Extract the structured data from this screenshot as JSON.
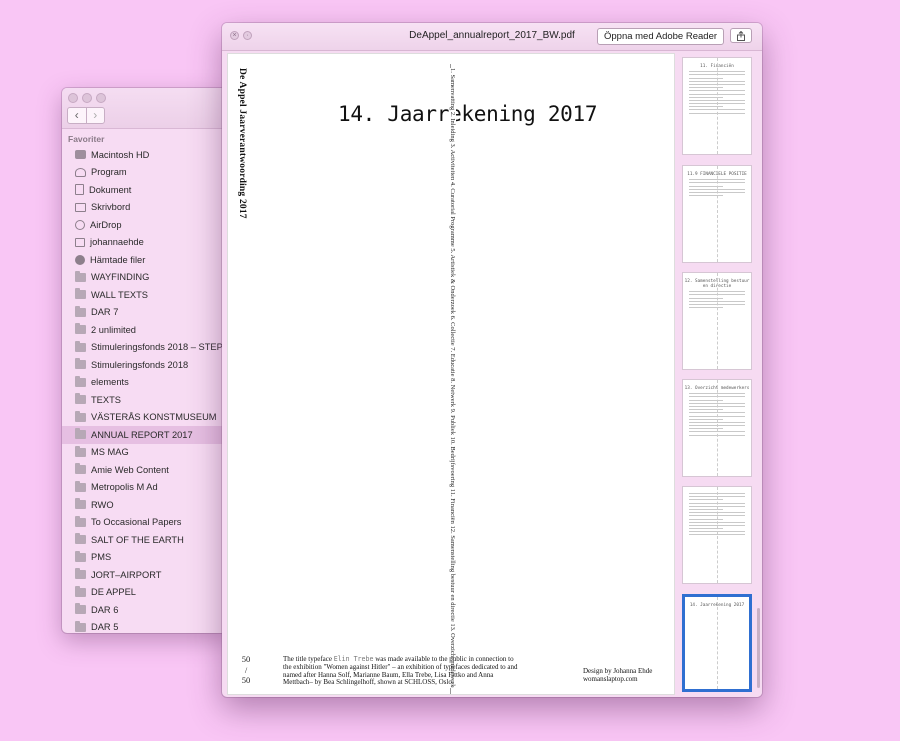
{
  "finder": {
    "favorites_label": "Favoriter",
    "items": [
      {
        "label": "Macintosh HD",
        "icon": "disk-icon"
      },
      {
        "label": "Program",
        "icon": "applications-icon"
      },
      {
        "label": "Dokument",
        "icon": "document-icon"
      },
      {
        "label": "Skrivbord",
        "icon": "desktop-icon"
      },
      {
        "label": "AirDrop",
        "icon": "airdrop-icon"
      },
      {
        "label": "johannaehde",
        "icon": "home-icon"
      },
      {
        "label": "Hämtade filer",
        "icon": "downloads-icon"
      },
      {
        "label": "WAYFINDING",
        "icon": "folder-icon"
      },
      {
        "label": "WALL TEXTS",
        "icon": "folder-icon"
      },
      {
        "label": "DAR 7",
        "icon": "folder-icon"
      },
      {
        "label": "2 unlimited",
        "icon": "folder-icon"
      },
      {
        "label": "Stimuleringsfonds 2018 – STEP",
        "icon": "folder-icon"
      },
      {
        "label": "Stimuleringsfonds 2018",
        "icon": "folder-icon"
      },
      {
        "label": "elements",
        "icon": "folder-icon"
      },
      {
        "label": "TEXTS",
        "icon": "folder-icon"
      },
      {
        "label": "VÄSTERÅS KONSTMUSEUM",
        "icon": "folder-icon"
      },
      {
        "label": "ANNUAL REPORT 2017",
        "icon": "folder-icon",
        "selected": true
      },
      {
        "label": "MS MAG",
        "icon": "folder-icon"
      },
      {
        "label": "Amie Web Content",
        "icon": "folder-icon"
      },
      {
        "label": "Metropolis M Ad",
        "icon": "folder-icon"
      },
      {
        "label": "RWO",
        "icon": "folder-icon"
      },
      {
        "label": "To Occasional Papers",
        "icon": "folder-icon"
      },
      {
        "label": "SALT OF THE EARTH",
        "icon": "folder-icon"
      },
      {
        "label": "PMS",
        "icon": "folder-icon"
      },
      {
        "label": "JORT–AIRPORT",
        "icon": "folder-icon"
      },
      {
        "label": "DE APPEL",
        "icon": "folder-icon"
      },
      {
        "label": "DAR 6",
        "icon": "folder-icon"
      },
      {
        "label": "DAR 5",
        "icon": "folder-icon"
      }
    ]
  },
  "pdf": {
    "filename": "DeAppel_annualreport_2017_BW.pdf",
    "open_button": "Öppna med Adobe Reader",
    "page": {
      "side_title": "De Appel  Jaarverantwoording 2017",
      "heading": "14. Jaarrekening 2017",
      "toc": "1. Samenvatting   2. Inleiding   3. Activiteiten   4. Curatorial Programme   5. Artistiek & Onderzoek   6. Collectie   7. Educatie   8. Netwerk   9. Publiek   10. Bedrijfsvoering   11. Financiën   12. Samenstelling bestuur en directie   13. Overzicht medewerkers   14. Jaarrekening 2017",
      "page_num_top": "50",
      "page_num_sep": "/",
      "page_num_bottom": "50",
      "credit_prefix": "The title typeface ",
      "credit_typeface": "Elin Trebe",
      "credit_suffix": " was made available to the public in connection to the exhibition \"Women against Hitler\" – an exhibition of typefaces dedicated to and named after Hanna Solf, Marianne Baum, Ella Trebe, Lisa Fittko and Anna Mettbach– by Bea Schlingelhoff, shown at SCHLOSS, Oslo.",
      "design_line1": "Design by Johanna Ehde",
      "design_line2": "womanslaptop.com"
    },
    "thumbnails": [
      {
        "title": "11. Financiën"
      },
      {
        "title": "11.9 FINANCIELE POSITIE"
      },
      {
        "title": "12. Samenstelling bestuur en directie"
      },
      {
        "title": "13. Overzicht medewerkers"
      },
      {
        "title": ""
      },
      {
        "title": "14. Jaarrekening 2017",
        "selected": true
      }
    ]
  }
}
